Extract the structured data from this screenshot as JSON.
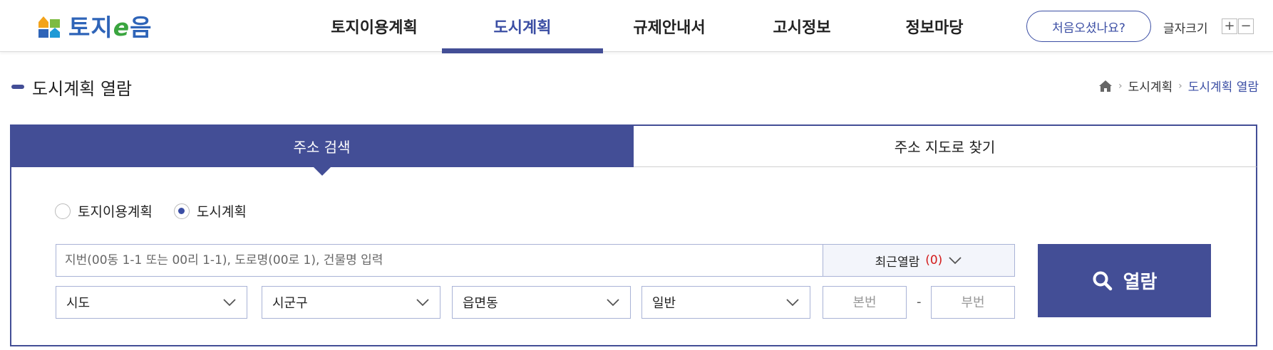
{
  "brand": {
    "name_prefix": "토지",
    "name_e": "e",
    "name_suffix": "음"
  },
  "nav": {
    "items": [
      {
        "label": "토지이용계획",
        "active": false
      },
      {
        "label": "도시계획",
        "active": true
      },
      {
        "label": "규제안내서",
        "active": false
      },
      {
        "label": "고시정보",
        "active": false
      },
      {
        "label": "정보마당",
        "active": false
      }
    ],
    "first_visit_button": "처음오셨나요?",
    "font_size_label": "글자크기",
    "font_increase": "+",
    "font_decrease": "−"
  },
  "page": {
    "title": "도시계획 열람",
    "breadcrumb": [
      "도시계획",
      "도시계획 열람"
    ]
  },
  "tabs": [
    {
      "label": "주소 검색",
      "active": true
    },
    {
      "label": "주소 지도로 찾기",
      "active": false
    }
  ],
  "plan_type": {
    "options": [
      "토지이용계획",
      "도시계획"
    ],
    "selected": "도시계획"
  },
  "search": {
    "placeholder": "지번(00동 1-1 또는 00리 1-1), 도로명(00로 1), 건물명 입력",
    "recent_label": "최근열람",
    "recent_count": "(0)"
  },
  "selects": {
    "sido": "시도",
    "sigungu": "시군구",
    "eupmyeondong": "읍면동",
    "land_type": "일반"
  },
  "lot": {
    "main_placeholder": "본번",
    "separator": "-",
    "sub_placeholder": "부번"
  },
  "view_button": "열람",
  "colors": {
    "primary": "#434e96",
    "accent_red": "#d31b1b",
    "logo_blue": "#2e64b8",
    "logo_green": "#3aa53f"
  }
}
